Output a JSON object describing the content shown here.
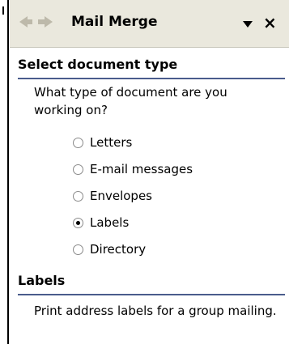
{
  "taskpane": {
    "title": "Mail Merge",
    "close_glyph": "×"
  },
  "section1": {
    "header": "Select document type",
    "question": "What type of document are you working on?",
    "options": [
      {
        "label": "Letters",
        "checked": false
      },
      {
        "label": "E-mail messages",
        "checked": false
      },
      {
        "label": "Envelopes",
        "checked": false
      },
      {
        "label": "Labels",
        "checked": true
      },
      {
        "label": "Directory",
        "checked": false
      }
    ]
  },
  "section2": {
    "header": "Labels",
    "description": "Print address labels for a group mailing."
  },
  "icons": {
    "back": "back-arrow-icon",
    "forward": "forward-arrow-icon",
    "menu": "dropdown-triangle-icon",
    "close": "close-icon"
  },
  "colors": {
    "titlebar_bg": "#eae8dd",
    "header_rule": "#4a5c8c"
  }
}
